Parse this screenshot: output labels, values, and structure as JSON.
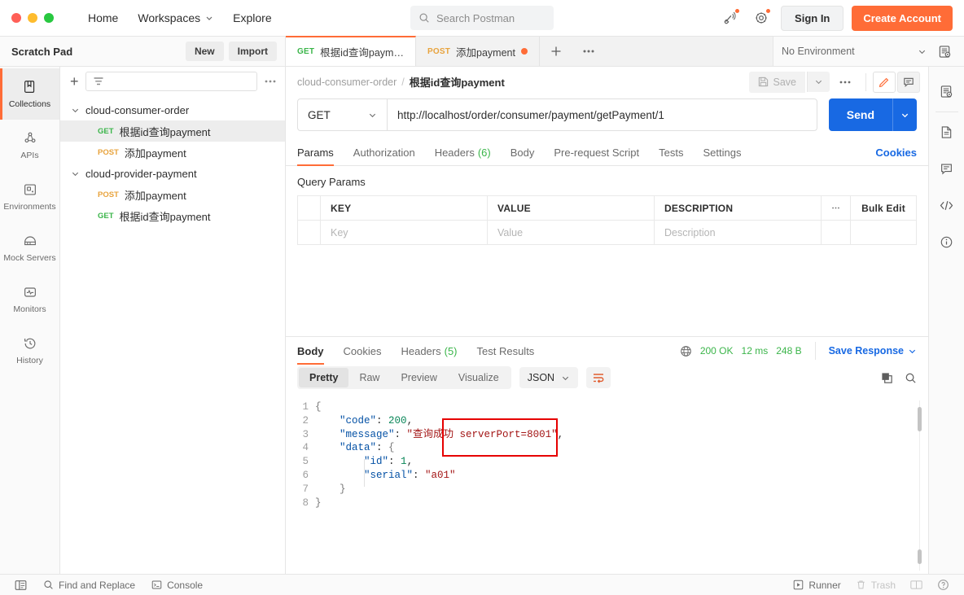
{
  "window": {
    "traffic_lights": [
      "close",
      "minimize",
      "maximize"
    ]
  },
  "topnav": {
    "items": [
      {
        "label": "Home",
        "has_caret": false
      },
      {
        "label": "Workspaces",
        "has_caret": true
      },
      {
        "label": "Explore",
        "has_caret": false
      }
    ],
    "search_placeholder": "Search Postman",
    "sign_in_label": "Sign In",
    "create_account_label": "Create Account",
    "icons": [
      "broadcast-icon",
      "gear-icon"
    ]
  },
  "sidebar_header": {
    "title": "Scratch Pad",
    "new_label": "New",
    "import_label": "Import"
  },
  "request_tabs": {
    "tabs": [
      {
        "method": "GET",
        "name": "根据id查询payment",
        "active": true,
        "unsaved": false
      },
      {
        "method": "POST",
        "name": "添加payment",
        "active": false,
        "unsaved": true
      }
    ],
    "add_tab_label": "+",
    "more_label": "•••"
  },
  "environment": {
    "selected": "No Environment"
  },
  "left_rail": {
    "items": [
      {
        "label": "Collections",
        "icon": "collections-icon",
        "active": true
      },
      {
        "label": "APIs",
        "icon": "apis-icon",
        "active": false
      },
      {
        "label": "Environments",
        "icon": "environments-icon",
        "active": false
      },
      {
        "label": "Mock Servers",
        "icon": "mock-servers-icon",
        "active": false
      },
      {
        "label": "Monitors",
        "icon": "monitors-icon",
        "active": false
      },
      {
        "label": "History",
        "icon": "history-icon",
        "active": false
      }
    ]
  },
  "collection_tree": {
    "filter_placeholder": "",
    "nodes": [
      {
        "name": "cloud-consumer-order",
        "expanded": true,
        "children": [
          {
            "method": "GET",
            "name": "根据id查询payment",
            "selected": true
          },
          {
            "method": "POST",
            "name": "添加payment",
            "selected": false
          }
        ]
      },
      {
        "name": "cloud-provider-payment",
        "expanded": true,
        "children": [
          {
            "method": "POST",
            "name": "添加payment",
            "selected": false
          },
          {
            "method": "GET",
            "name": "根据id查询payment",
            "selected": false
          }
        ]
      }
    ]
  },
  "breadcrumb": {
    "collection": "cloud-consumer-order",
    "separator": "/",
    "current": "根据id查询payment",
    "save_label": "Save"
  },
  "url_bar": {
    "method": "GET",
    "url": "http://localhost/order/consumer/payment/getPayment/1",
    "send_label": "Send"
  },
  "request_section": {
    "tabs": [
      {
        "label": "Params",
        "count": "",
        "active": true
      },
      {
        "label": "Authorization",
        "count": "",
        "active": false
      },
      {
        "label": "Headers",
        "count": "(6)",
        "active": false
      },
      {
        "label": "Body",
        "count": "",
        "active": false
      },
      {
        "label": "Pre-request Script",
        "count": "",
        "active": false
      },
      {
        "label": "Tests",
        "count": "",
        "active": false
      },
      {
        "label": "Settings",
        "count": "",
        "active": false
      }
    ],
    "cookies_label": "Cookies",
    "query_params_title": "Query Params",
    "table": {
      "headers": [
        "KEY",
        "VALUE",
        "DESCRIPTION"
      ],
      "bulk_edit_label": "Bulk Edit",
      "rows": [
        {
          "key_placeholder": "Key",
          "value_placeholder": "Value",
          "description_placeholder": "Description"
        }
      ]
    }
  },
  "response_section": {
    "tabs": [
      {
        "label": "Body",
        "count": "",
        "active": true
      },
      {
        "label": "Cookies",
        "count": "",
        "active": false
      },
      {
        "label": "Headers",
        "count": "(5)",
        "active": false
      },
      {
        "label": "Test Results",
        "count": "",
        "active": false
      }
    ],
    "status": "200 OK",
    "time": "12 ms",
    "size": "248 B",
    "save_response_label": "Save Response",
    "view_modes": [
      {
        "label": "Pretty",
        "active": true
      },
      {
        "label": "Raw",
        "active": false
      },
      {
        "label": "Preview",
        "active": false
      },
      {
        "label": "Visualize",
        "active": false
      }
    ],
    "format": "JSON",
    "body_lines": [
      {
        "n": "1",
        "text": "{"
      },
      {
        "n": "2",
        "text": "    \"code\": 200,"
      },
      {
        "n": "3",
        "text": "    \"message\": \"查询成功 serverPort=8001\","
      },
      {
        "n": "4",
        "text": "    \"data\": {"
      },
      {
        "n": "5",
        "text": "        \"id\": 1,"
      },
      {
        "n": "6",
        "text": "        \"serial\": \"a01\""
      },
      {
        "n": "7",
        "text": "    }"
      },
      {
        "n": "8",
        "text": "}"
      }
    ],
    "annotation": {
      "color": "#e60000",
      "highlights": "serverPort=8001"
    }
  },
  "right_rail": {
    "items": [
      {
        "icon": "environment-quick-look-icon"
      },
      {
        "icon": "documentation-icon"
      },
      {
        "icon": "comments-icon"
      },
      {
        "icon": "code-snippet-icon"
      },
      {
        "icon": "info-icon"
      }
    ]
  },
  "status_bar": {
    "left": [
      {
        "label": "",
        "icon": "sidebar-toggle-icon"
      },
      {
        "label": "Find and Replace",
        "icon": "search-icon"
      },
      {
        "label": "Console",
        "icon": "console-icon"
      }
    ],
    "right": [
      {
        "label": "Runner",
        "icon": "runner-icon"
      },
      {
        "label": "Trash",
        "icon": "trash-icon"
      },
      {
        "label": "",
        "icon": "layout-icon"
      },
      {
        "label": "",
        "icon": "help-icon"
      }
    ]
  },
  "colors": {
    "accent": "#ff6c37",
    "send_blue": "#1869e3",
    "get_green": "#3bb54a",
    "post_orange": "#e8a33d",
    "annotation_red": "#e60000"
  }
}
